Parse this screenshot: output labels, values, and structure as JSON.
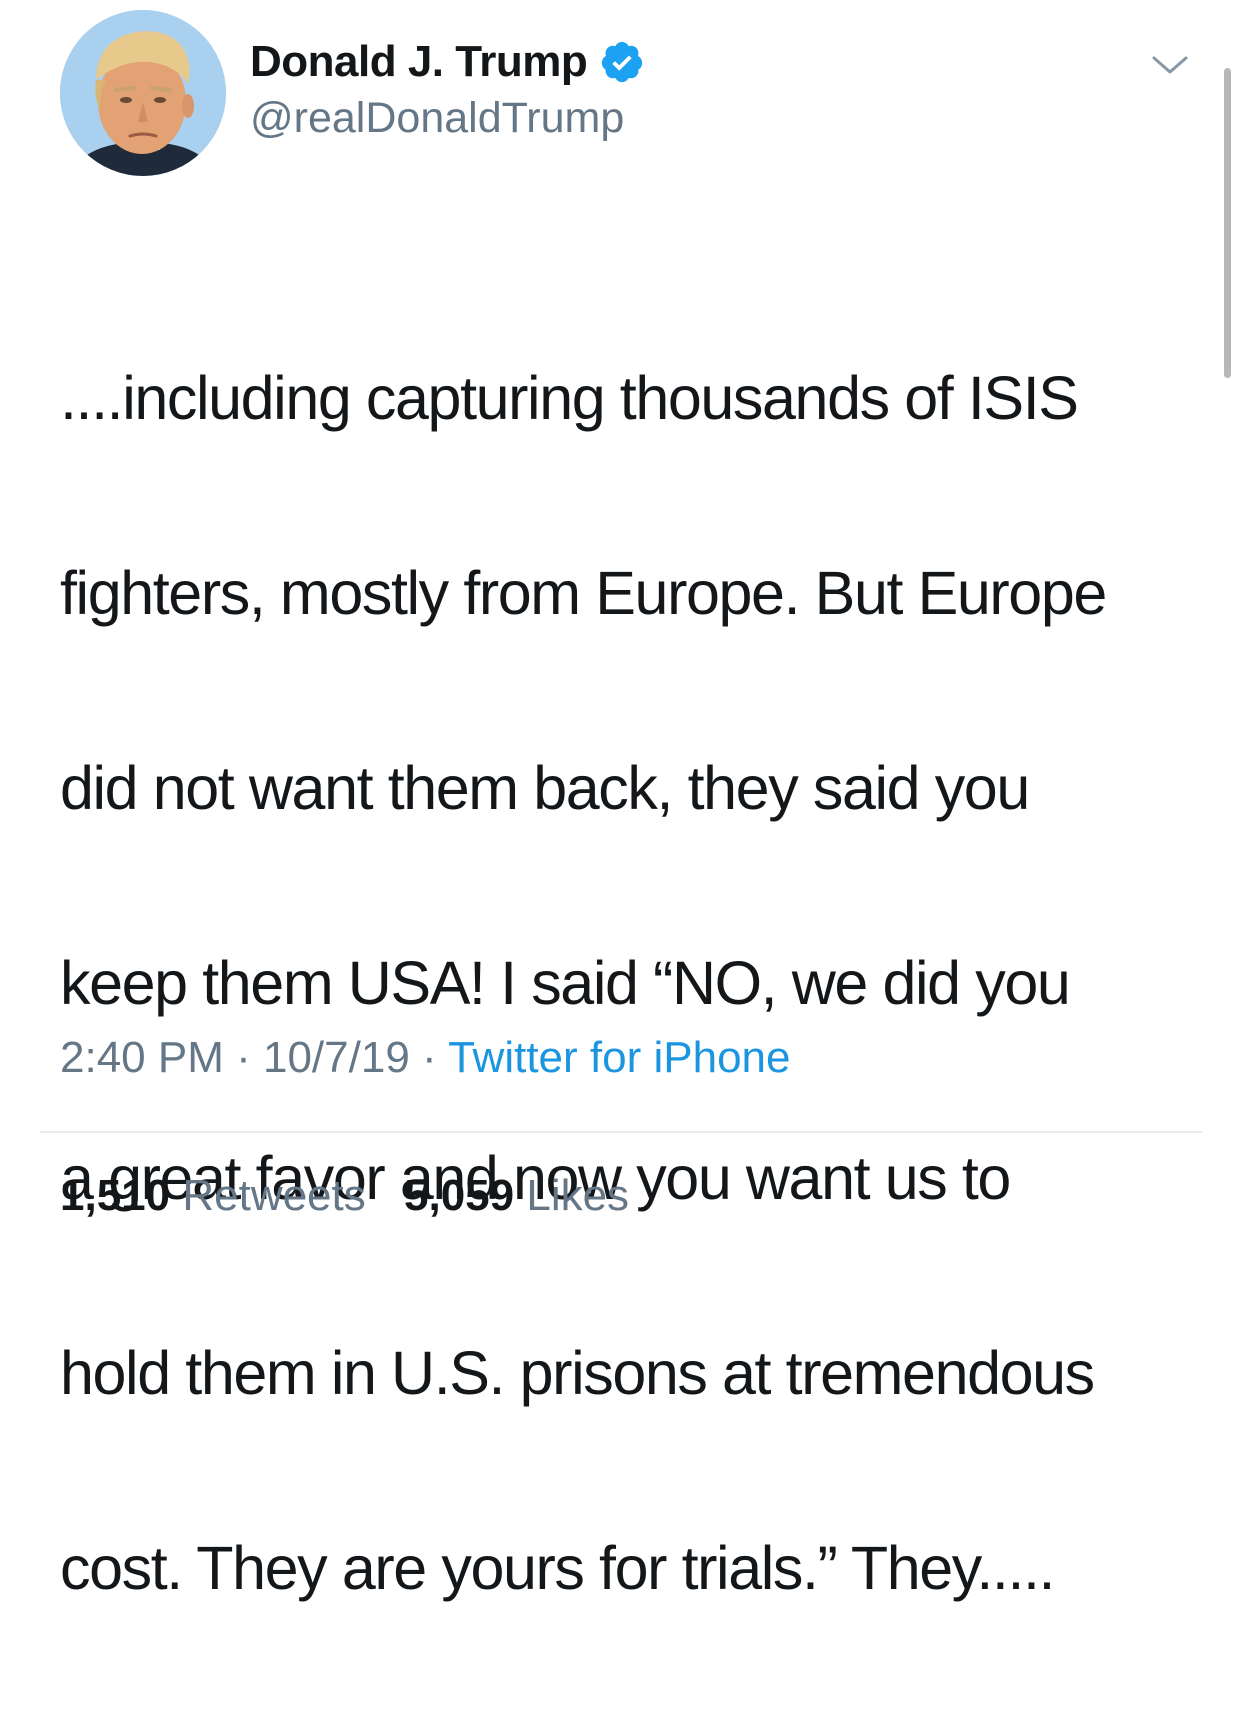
{
  "author": {
    "display_name": "Donald J. Trump",
    "handle": "@realDonaldTrump",
    "verified_icon": "verified-badge-icon",
    "avatar_icon": "profile-photo"
  },
  "tweet": {
    "lines": [
      "....including capturing thousands of ISIS",
      "fighters, mostly from Europe. But Europe",
      "did not want them back, they said you",
      "keep them USA! I said “NO, we did you",
      "a great favor and now you want us to",
      "hold them in U.S. prisons at tremendous",
      "cost. They are yours for trials.” They....."
    ]
  },
  "meta": {
    "time": "2:40 PM",
    "separator": " · ",
    "date": "10/7/19",
    "source": "Twitter for iPhone"
  },
  "stats": {
    "retweets_count": "1,510",
    "retweets_label": "Retweets",
    "likes_count": "5,059",
    "likes_label": "Likes"
  },
  "colors": {
    "text": "#14171a",
    "secondary": "#657786",
    "link": "#1b95e0",
    "verified": "#1da1f2",
    "divider": "#e6ecf0"
  },
  "icons": {
    "more_menu": "chevron-down-icon"
  }
}
